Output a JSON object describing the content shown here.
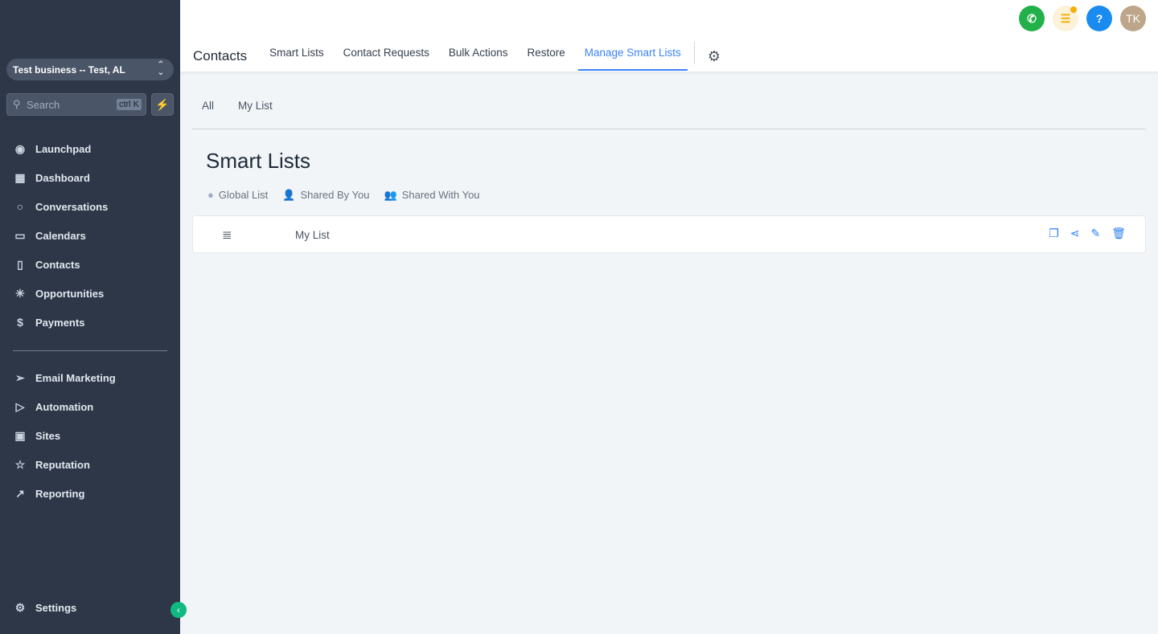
{
  "sidebar": {
    "location": "Test business -- Test, AL",
    "search_placeholder": "Search",
    "shortcut": "ctrl K",
    "items": [
      {
        "label": "Launchpad",
        "icon": "rocket-icon"
      },
      {
        "label": "Dashboard",
        "icon": "grid-icon"
      },
      {
        "label": "Conversations",
        "icon": "chat-icon"
      },
      {
        "label": "Calendars",
        "icon": "calendar-icon"
      },
      {
        "label": "Contacts",
        "icon": "contacts-icon"
      },
      {
        "label": "Opportunities",
        "icon": "opportunities-icon"
      },
      {
        "label": "Payments",
        "icon": "payments-icon"
      }
    ],
    "items2": [
      {
        "label": "Email Marketing",
        "icon": "send-icon"
      },
      {
        "label": "Automation",
        "icon": "play-icon"
      },
      {
        "label": "Sites",
        "icon": "sites-icon"
      },
      {
        "label": "Reputation",
        "icon": "star-icon"
      },
      {
        "label": "Reporting",
        "icon": "trend-icon"
      }
    ],
    "settings": "Settings"
  },
  "header": {
    "avatar": "TK",
    "help": "?",
    "colors": {
      "phone": "#22b04b",
      "tasks": "#fbf2d9",
      "help": "#1a8cf0",
      "avatar": "#bda68a"
    }
  },
  "tabs": {
    "title": "Contacts",
    "items": [
      "Smart Lists",
      "Contact Requests",
      "Bulk Actions",
      "Restore",
      "Manage Smart Lists"
    ],
    "active": "Manage Smart Lists"
  },
  "subtabs": [
    "All",
    "My List"
  ],
  "page": {
    "title": "Smart Lists",
    "filters": [
      "Global List",
      "Shared By You",
      "Shared With You"
    ],
    "rows": [
      {
        "name": "My List"
      }
    ]
  }
}
